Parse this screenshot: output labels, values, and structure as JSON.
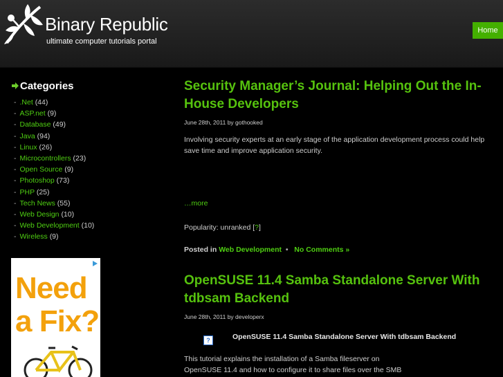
{
  "header": {
    "site_title": "Binary Republic",
    "tagline": "ultimate computer tutorials portal",
    "nav": {
      "home": "Home"
    }
  },
  "sidebar": {
    "categories_title": "Categories",
    "categories": [
      {
        "name": ".Net",
        "count": "(44)"
      },
      {
        "name": "ASP.net",
        "count": "(9)"
      },
      {
        "name": "Database",
        "count": "(49)"
      },
      {
        "name": "Java",
        "count": "(94)"
      },
      {
        "name": "Linux",
        "count": "(26)"
      },
      {
        "name": "Microcontrollers",
        "count": "(23)"
      },
      {
        "name": "Open Source",
        "count": "(9)"
      },
      {
        "name": "Photoshop",
        "count": "(73)"
      },
      {
        "name": "PHP",
        "count": "(25)"
      },
      {
        "name": "Tech News",
        "count": "(55)"
      },
      {
        "name": "Web Design",
        "count": "(10)"
      },
      {
        "name": "Web Development",
        "count": "(10)"
      },
      {
        "name": "Wireless",
        "count": "(9)"
      }
    ],
    "ad": {
      "line1": "Need",
      "line2": "a Fix?"
    }
  },
  "posts": [
    {
      "title": "Security Manager’s Journal: Helping Out the In-House Developers",
      "meta": "June 28th, 2011 by gothooked",
      "excerpt": "Involving security experts at an early stage of the application development process could help save time and improve application security.",
      "more": "…more",
      "popularity_label": "Popularity: unranked [",
      "popularity_q": "?",
      "popularity_end": "]",
      "posted_in_label": "Posted in",
      "category": "Web Development",
      "comments": "No Comments »"
    },
    {
      "title": "OpenSUSE 11.4 Samba Standalone Server With tdbsam Backend",
      "meta": "June 28th, 2011 by developerx",
      "image_caption": "OpenSUSE 11.4 Samba Standalone Server With tdbsam Backend",
      "thumb_glyph": "?",
      "excerpt_line1": "This tutorial explains the installation of a Samba fileserver on",
      "excerpt_line2": "OpenSUSE 11.4 and how to configure it to share files over the SMB"
    }
  ]
}
